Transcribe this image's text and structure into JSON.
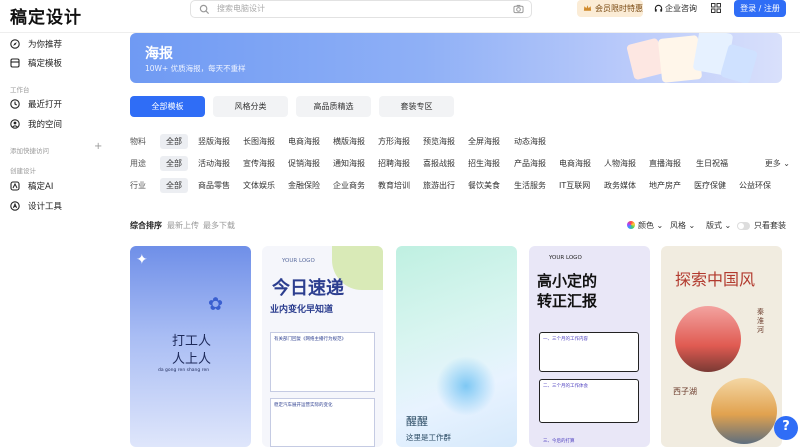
{
  "app": {
    "logo": "稿定设计"
  },
  "search": {
    "placeholder": "搜索电脑设计"
  },
  "header": {
    "vip_label": "会员限时特惠",
    "enterprise_label": "企业咨询",
    "login_label": "登录 / 注册"
  },
  "sidebar": {
    "items": [
      {
        "label": "为你推荐",
        "icon": "compass-icon"
      },
      {
        "label": "稿定模板",
        "icon": "template-icon"
      }
    ],
    "group_workspace": "工作台",
    "workspace_items": [
      {
        "label": "最近打开",
        "icon": "clock-icon"
      },
      {
        "label": "我的空间",
        "icon": "user-icon"
      }
    ],
    "group_quick": "添加快捷访问",
    "group_create": "创建设计",
    "create_items": [
      {
        "label": "稿定AI",
        "icon": "ai-icon"
      },
      {
        "label": "设计工具",
        "icon": "tool-icon"
      }
    ]
  },
  "banner": {
    "title": "海报",
    "subtitle": "10W+ 优质海报，每天不重样"
  },
  "tabs": [
    {
      "label": "全部模板",
      "active": true
    },
    {
      "label": "风格分类"
    },
    {
      "label": "高品质精选"
    },
    {
      "label": "套装专区"
    }
  ],
  "filters": [
    {
      "label": "物料",
      "items": [
        "全部",
        "竖版海报",
        "长图海报",
        "电商海报",
        "横版海报",
        "方形海报",
        "预览海报",
        "全屏海报",
        "动态海报"
      ]
    },
    {
      "label": "用途",
      "items": [
        "全部",
        "活动海报",
        "宣传海报",
        "促销海报",
        "通知海报",
        "招聘海报",
        "喜报战报",
        "招生海报",
        "产品海报",
        "电商海报",
        "人物海报",
        "直播海报",
        "生日祝福"
      ],
      "more": "更多"
    },
    {
      "label": "行业",
      "items": [
        "全部",
        "商品零售",
        "文体娱乐",
        "金融保险",
        "企业商务",
        "教育培训",
        "旅游出行",
        "餐饮美食",
        "生活服务",
        "IT互联网",
        "政务媒体",
        "地产房产",
        "医疗保健",
        "公益环保"
      ]
    }
  ],
  "sortbar": {
    "sorts": [
      "综合排序",
      "最新上传",
      "最多下载"
    ],
    "options": [
      "颜色",
      "风格",
      "版式"
    ],
    "toggle_label": "只看套装"
  },
  "cards": {
    "c1": {
      "line1": "打工人",
      "line2": "人上人",
      "pinyin": "da gong ren shang ren"
    },
    "c2": {
      "logo": "YOUR LOGO",
      "headline": "今日速递",
      "sub": "业内变化早知道",
      "sec1": "有关部门回复《网络主播行为规范》",
      "sec2": "稳定汽车展开运营实际的变化"
    },
    "c3": {
      "word": "醒醒",
      "sub": "这里是工作群"
    },
    "c4": {
      "logo": "YOUR LOGO",
      "line1": "高小定的",
      "line2": "转正汇报",
      "sec1": "一、三个月的工作内容",
      "sec2": "二、三个月的工作体会",
      "sec3": "三、今后的打算"
    },
    "c5": {
      "title": "探索中国风",
      "place1": "秦淮河",
      "place2": "西子湖"
    }
  },
  "help": {
    "label": "?"
  },
  "colors": {
    "accent": "#2f6df6",
    "vip_bg": "#fbecd6"
  }
}
